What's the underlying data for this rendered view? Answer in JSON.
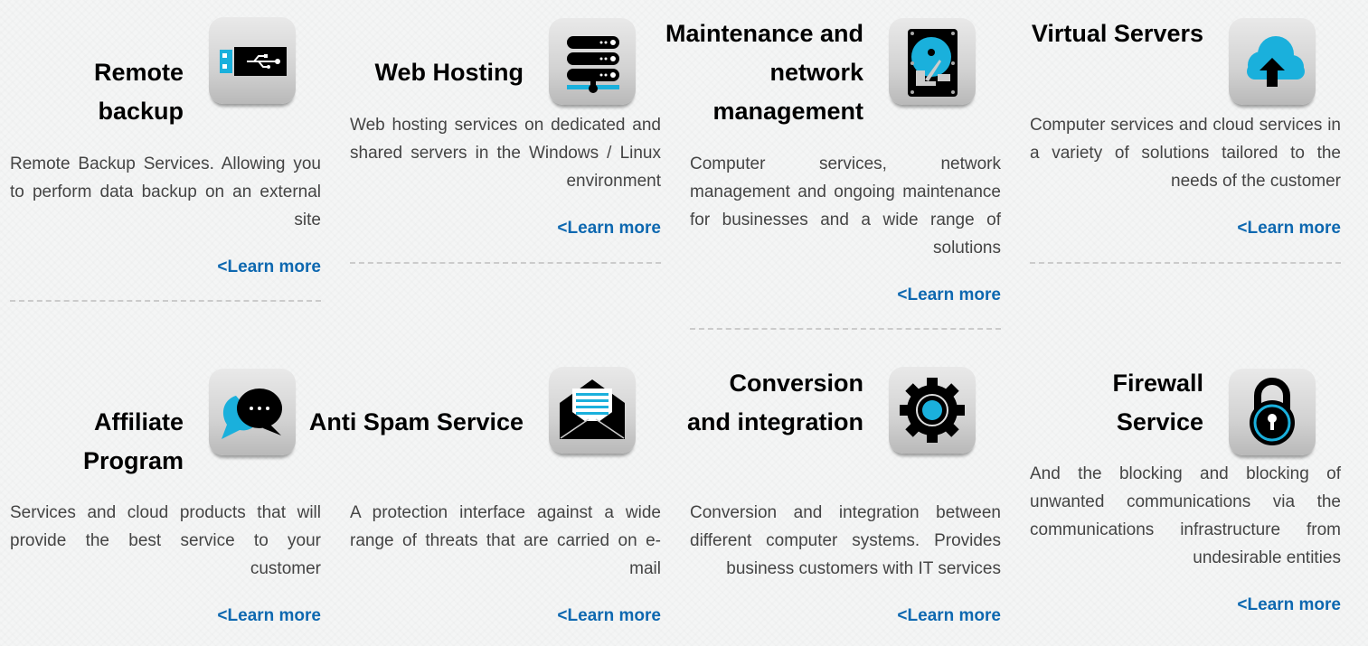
{
  "colors": {
    "link": "#0d68b0",
    "accent": "#1ab0dc",
    "text": "#444444",
    "title": "#000000"
  },
  "services": [
    {
      "title": "Remote backup",
      "icon": "usb-drive-icon",
      "description": "Remote Backup Services. Allowing you to perform data backup on an external site",
      "link": "<Learn more"
    },
    {
      "title": "Web Hosting",
      "icon": "server-stack-icon",
      "description": "Web hosting services on dedicated and shared servers in the Windows / Linux environment",
      "link": "<Learn more"
    },
    {
      "title": "Maintenance and network management",
      "icon": "hard-drive-icon",
      "description": "Computer services, network management and ongoing maintenance for businesses and a wide range of solutions",
      "link": "<Learn more"
    },
    {
      "title": "Virtual Servers",
      "icon": "cloud-upload-icon",
      "description": "Computer services and cloud services in a variety of solutions tailored to the needs of the customer",
      "link": "<Learn more"
    },
    {
      "title": "Affiliate Program",
      "icon": "chat-bubbles-icon",
      "description": "Services and cloud products that will provide the best service to your customer",
      "link": "<Learn more"
    },
    {
      "title": "Anti Spam Service",
      "icon": "envelope-icon",
      "description": "A protection interface against a wide range of threats that are carried on e-mail",
      "link": "<Learn more"
    },
    {
      "title": "Conversion and integration",
      "icon": "gear-icon",
      "description": "Conversion and integration between different computer systems. Provides business customers with IT services",
      "link": "<Learn more"
    },
    {
      "title": "Firewall Service",
      "icon": "padlock-icon",
      "description": "And the blocking and blocking of unwanted communications via the communications infrastructure from undesirable entities",
      "link": "<Learn more"
    }
  ]
}
